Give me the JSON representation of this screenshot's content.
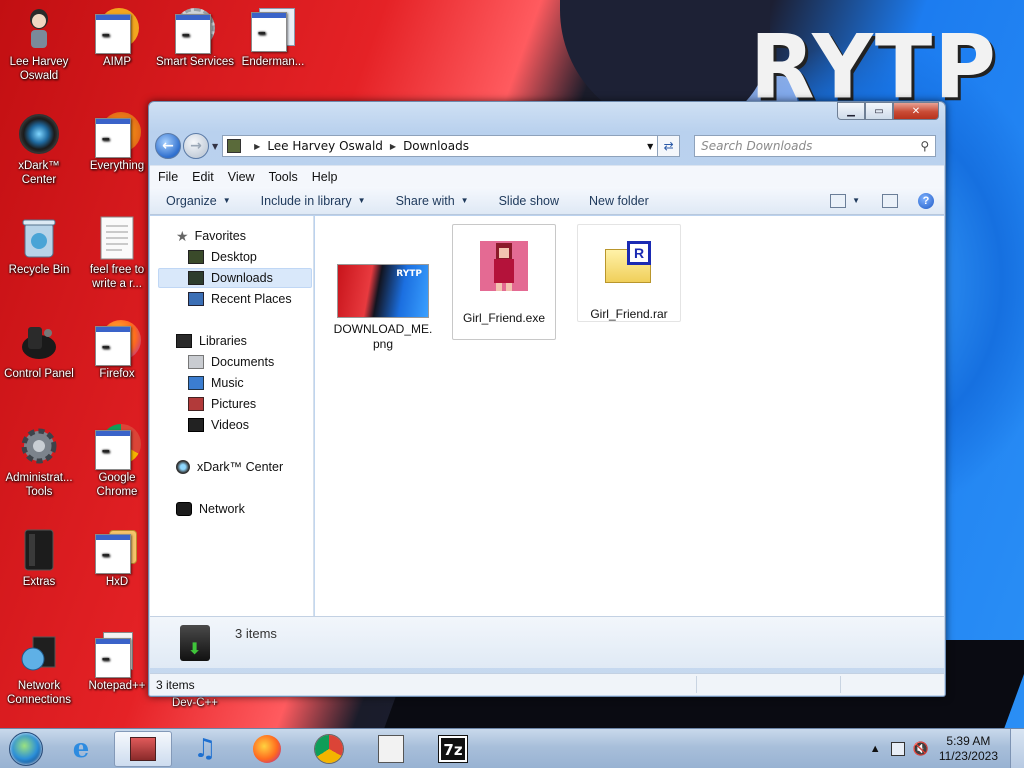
{
  "desktop": {
    "icons": [
      {
        "label": "Lee Harvey Oswald",
        "icon": "user-folder-icon"
      },
      {
        "label": "AIMP",
        "icon": "aimp-icon"
      },
      {
        "label": "Smart Services",
        "icon": "services-gear-icon"
      },
      {
        "label": "Enderman...",
        "icon": "app-icon"
      },
      {
        "label": "xDark™ Center",
        "icon": "xdark-center-icon"
      },
      {
        "label": "Everything",
        "icon": "everything-search-icon"
      },
      {
        "label": "Recycle Bin",
        "icon": "recycle-bin-icon"
      },
      {
        "label": "feel free to write a r...",
        "icon": "text-document-icon"
      },
      {
        "label": "Control Panel",
        "icon": "control-panel-icon"
      },
      {
        "label": "Firefox",
        "icon": "firefox-icon"
      },
      {
        "label": "Administrat... Tools",
        "icon": "admin-tools-icon"
      },
      {
        "label": "Google Chrome",
        "icon": "chrome-icon"
      },
      {
        "label": "Extras",
        "icon": "extras-folder-icon"
      },
      {
        "label": "HxD",
        "icon": "hxd-icon"
      },
      {
        "label": "Network Connections",
        "icon": "network-connections-icon"
      },
      {
        "label": "Notepad++",
        "icon": "notepadpp-icon"
      },
      {
        "label": "Dev-C++",
        "icon": "devcpp-icon"
      }
    ],
    "wallpaper_text": "RYTP"
  },
  "explorer": {
    "address": {
      "segments": [
        "Lee Harvey Oswald",
        "Downloads"
      ]
    },
    "search": {
      "placeholder": "Search Downloads"
    },
    "menu": [
      "File",
      "Edit",
      "View",
      "Tools",
      "Help"
    ],
    "commands": {
      "organize": "Organize",
      "include": "Include in library",
      "share": "Share with",
      "slideshow": "Slide show",
      "newfolder": "New folder"
    },
    "nav": {
      "favorites": "Favorites",
      "desktop": "Desktop",
      "downloads": "Downloads",
      "recent": "Recent Places",
      "libraries": "Libraries",
      "documents": "Documents",
      "music": "Music",
      "pictures": "Pictures",
      "videos": "Videos",
      "xdark": "xDark™ Center",
      "network": "Network"
    },
    "files": [
      {
        "name": "DOWNLOAD_ME.png",
        "line1": "DOWNLOAD_ME.",
        "line2": "png",
        "thumb_text": "RYTP"
      },
      {
        "name": "Girl_Friend.exe"
      },
      {
        "name": "Girl_Friend.rar",
        "badge": "R"
      }
    ],
    "details": {
      "count": "3 items"
    },
    "status": {
      "count": "3 items"
    }
  },
  "taskbar": {
    "items": [
      "explorer",
      "internet-explorer",
      "music",
      "firefox",
      "chrome",
      "notepadpp",
      "7zip"
    ],
    "sevenzip_label": "7z",
    "clock": {
      "time": "5:39 AM",
      "date": "11/23/2023"
    }
  },
  "colors": {
    "accent": "#2f6fce",
    "selection": "#d9e8fa",
    "taskbar": "#a8bfda"
  }
}
